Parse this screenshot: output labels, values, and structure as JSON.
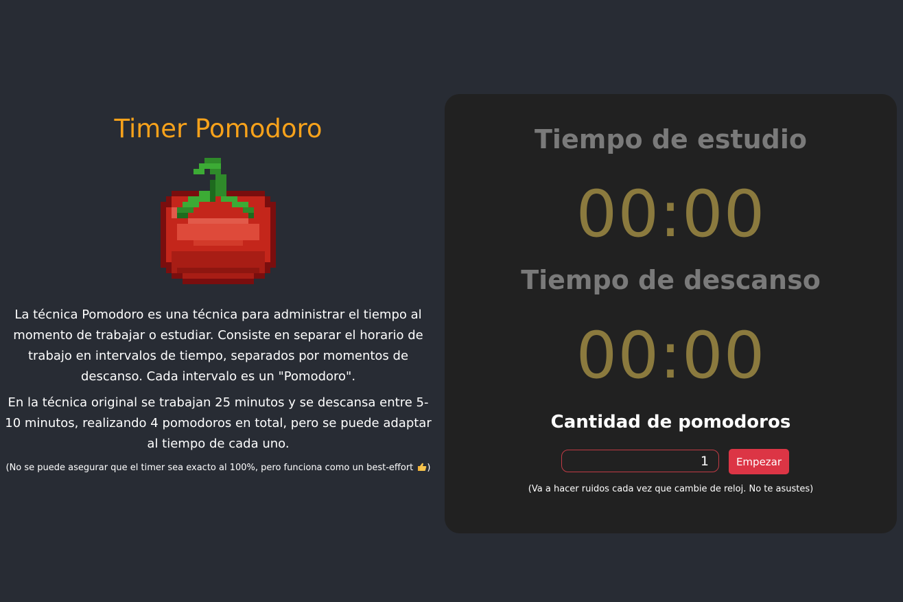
{
  "intro": {
    "title": "Timer Pomodoro",
    "paragraph_1": "La técnica Pomodoro es una técnica para administrar el tiempo al momento de trabajar o estudiar. Consiste en separar el horario de trabajo en intervalos de tiempo, separados por momentos de descanso. Cada intervalo es un \"Pomodoro\".",
    "paragraph_2": "En la técnica original se trabajan 25 minutos y se descansa entre 5-10 minutos, realizando 4 pomodoros en total, pero se puede adaptar al tiempo de cada uno.",
    "note": "(No se puede asegurar que el timer sea exacto al 100%, pero funciona como un best-effort",
    "note_end": ")",
    "image_icon": "pixel-tomato-icon"
  },
  "timer": {
    "study_label": "Tiempo de estudio",
    "study_time": "00:00",
    "break_label": "Tiempo de descanso",
    "break_time": "00:00",
    "count_label": "Cantidad de pomodoros",
    "count_value": "1",
    "start_button": "Empezar",
    "warning": "(Va a hacer ruidos cada vez que cambie de reloj. No te asustes)"
  },
  "colors": {
    "background": "#282c34",
    "card": "#212121",
    "title_accent": "#f7a21b",
    "clock": "#8b7a3e",
    "label": "#7a7a7a",
    "button": "#dc3545"
  }
}
